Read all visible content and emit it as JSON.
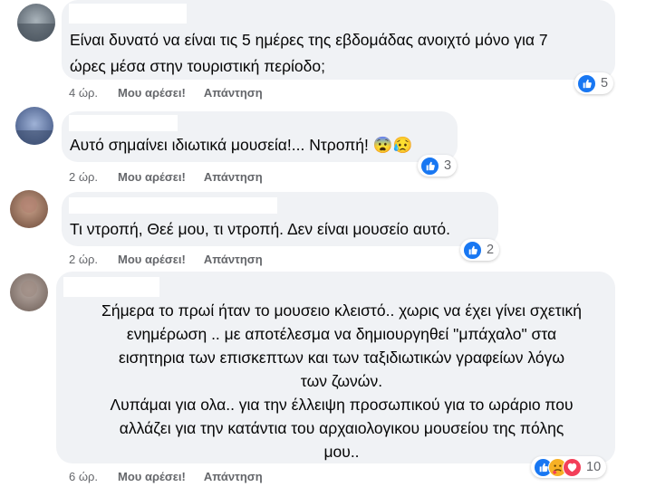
{
  "comments": [
    {
      "text": "Είναι δυνατό να είναι τις 5 ημέρες της εβδομάδας ανοιχτό μόνο για 7\nώρες μέσα στην τουριστική περίοδο;",
      "time": "4 ώρ.",
      "like_label": "Μου αρέσει!",
      "reply_label": "Απάντηση",
      "reaction_count": "5",
      "reactions": [
        "like"
      ]
    },
    {
      "text": "Αυτό σημαίνει ιδιωτικά μουσεία!... Ντροπή! 😨😥",
      "time": "2 ώρ.",
      "like_label": "Μου αρέσει!",
      "reply_label": "Απάντηση",
      "reaction_count": "3",
      "reactions": [
        "like"
      ]
    },
    {
      "text": "Τι ντροπή, Θεέ μου, τι ντροπή. Δεν είναι μουσείο αυτό.",
      "time": "2 ώρ.",
      "like_label": "Μου αρέσει!",
      "reply_label": "Απάντηση",
      "reaction_count": "2",
      "reactions": [
        "like"
      ]
    },
    {
      "text": "Σήμερα το πρωί ήταν το μουσειο κλειστό.. χωρις να έχει γίνει σχετική\nενημέρωση .. με αποτέλεσμα να δημιουργηθεί \"μπάχαλο\" στα\nεισητηρια των επισκεπτων και των ταξιδιωτικών γραφείων λόγω\nτων ζωνών.\nΛυπάμαι για ολα.. για την έλλειψη προσωπικού για το ωράριο που\nαλλάζει για την κατάντια του αρχαιολογικου μουσείου της πόλης\nμου..",
      "time": "6 ώρ.",
      "like_label": "Μου αρέσει!",
      "reply_label": "Απάντηση",
      "reaction_count": "10",
      "reactions": [
        "like",
        "care",
        "love"
      ]
    }
  ],
  "colors": {
    "bubble": "#f0f2f5",
    "meta_text": "#65676b",
    "like_blue": "#1877f2",
    "love_red": "#f33e58",
    "care_yellow": "#f7b125"
  },
  "icons": {
    "like": "thumbs-up-icon",
    "care": "care-icon",
    "love": "heart-icon"
  }
}
